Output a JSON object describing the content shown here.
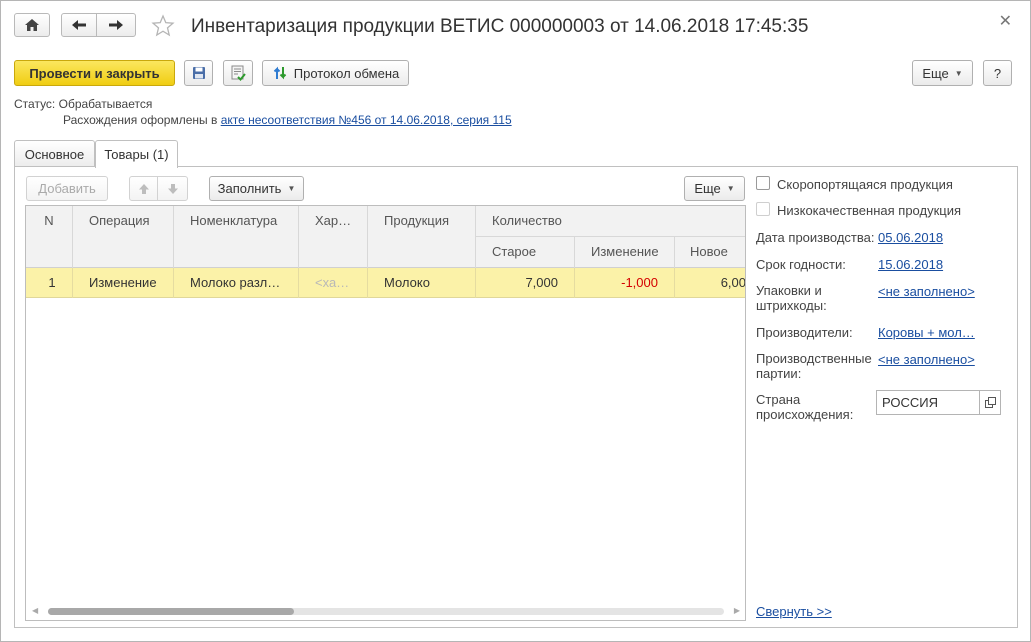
{
  "window": {
    "title": "Инвентаризация продукции ВЕТИС 000000003 от 14.06.2018 17:45:35"
  },
  "toolbar": {
    "post_close_label": "Провести и закрыть",
    "exchange_log_label": "Протокол обмена",
    "more_label": "Еще",
    "help_label": "?"
  },
  "status": {
    "label": "Статус:",
    "value": "Обрабатывается",
    "discrepancy_prefix": "Расхождения оформлены в",
    "discrepancy_link": "акте несоответствия №456 от 14.06.2018, серия 115"
  },
  "tabs": [
    {
      "label": "Основное"
    },
    {
      "label": "Товары (1)"
    }
  ],
  "table_toolbar": {
    "add_label": "Добавить",
    "fill_label": "Заполнить",
    "more_label": "Еще"
  },
  "table": {
    "headers": {
      "n": "N",
      "operation": "Операция",
      "nomenclature": "Номенклатура",
      "characteristic": "Хар…",
      "product": "Продукция",
      "quantity": "Количество",
      "old": "Старое",
      "change": "Изменение",
      "new": "Новое"
    },
    "rows": [
      {
        "n": "1",
        "operation": "Изменение",
        "nomenclature": "Молоко разл…",
        "characteristic": "<ха…",
        "product": "Молоко",
        "old": "7,000",
        "change": "-1,000",
        "new": "6,00"
      }
    ]
  },
  "details": {
    "perishable_label": "Скоропортящаяся продукция",
    "low_quality_label": "Низкокачественная продукция",
    "production_date_label": "Дата производства:",
    "production_date": "05.06.2018",
    "expiry_label": "Срок годности:",
    "expiry_date": "15.06.2018",
    "packaging_label_1": "Упаковки и",
    "packaging_label_2": "штрихкоды:",
    "packaging_value": "<не заполнено>",
    "producers_label": "Производители:",
    "producers_value": "Коровы + мол…",
    "batches_label_1": "Производственные",
    "batches_label_2": "партии:",
    "batches_value": "<не заполнено>",
    "country_label_1": "Страна",
    "country_label_2": "происхождения:",
    "country_value": "РОССИЯ",
    "collapse_label": "Свернуть >>"
  },
  "colors": {
    "primary_button": "#f0cd12",
    "selected_row": "#fbf2a8",
    "link": "#1a4ea0",
    "negative": "#d40000"
  }
}
